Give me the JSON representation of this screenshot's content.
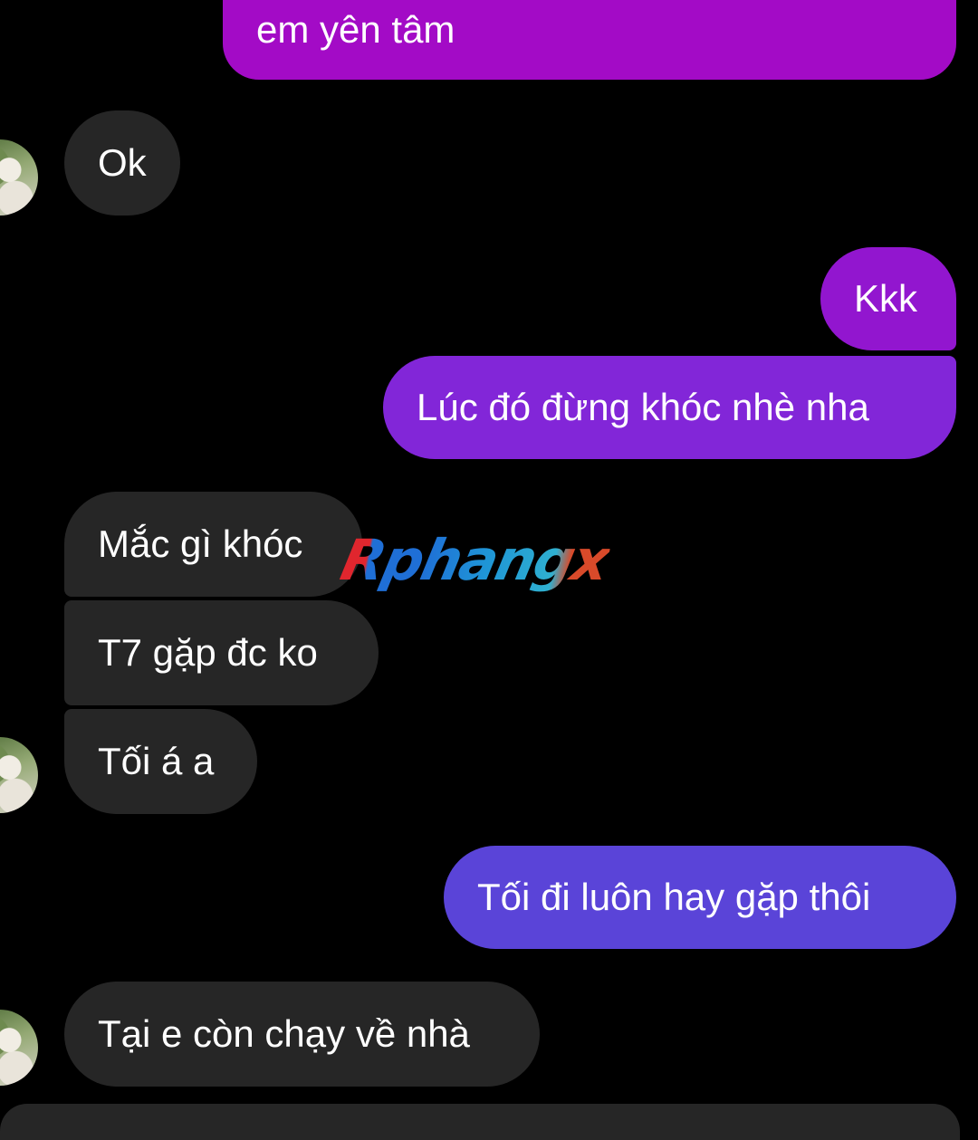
{
  "colors": {
    "background": "#000000",
    "incoming_bubble": "#262626",
    "outgoing_gradient": [
      "#a30bc6",
      "#8624d6",
      "#5a44d8"
    ]
  },
  "watermark": "Rphangx",
  "messages": [
    {
      "id": "m1",
      "direction": "outgoing",
      "text": "em yên tâm"
    },
    {
      "id": "m2",
      "direction": "incoming",
      "text": "Ok",
      "avatar": "sender-avatar"
    },
    {
      "id": "m3",
      "direction": "outgoing",
      "text": "Kkk"
    },
    {
      "id": "m4",
      "direction": "outgoing",
      "text": "Lúc đó đừng khóc nhè nha"
    },
    {
      "id": "m5",
      "direction": "incoming",
      "text": "Mắc gì khóc"
    },
    {
      "id": "m6",
      "direction": "incoming",
      "text": "T7 gặp đc ko"
    },
    {
      "id": "m7",
      "direction": "incoming",
      "text": "Tối á a",
      "avatar": "sender-avatar"
    },
    {
      "id": "m8",
      "direction": "outgoing",
      "text": "Tối đi luôn hay gặp thôi"
    },
    {
      "id": "m9",
      "direction": "incoming",
      "text": "Tại e còn chạy về nhà",
      "avatar": "sender-avatar"
    }
  ]
}
